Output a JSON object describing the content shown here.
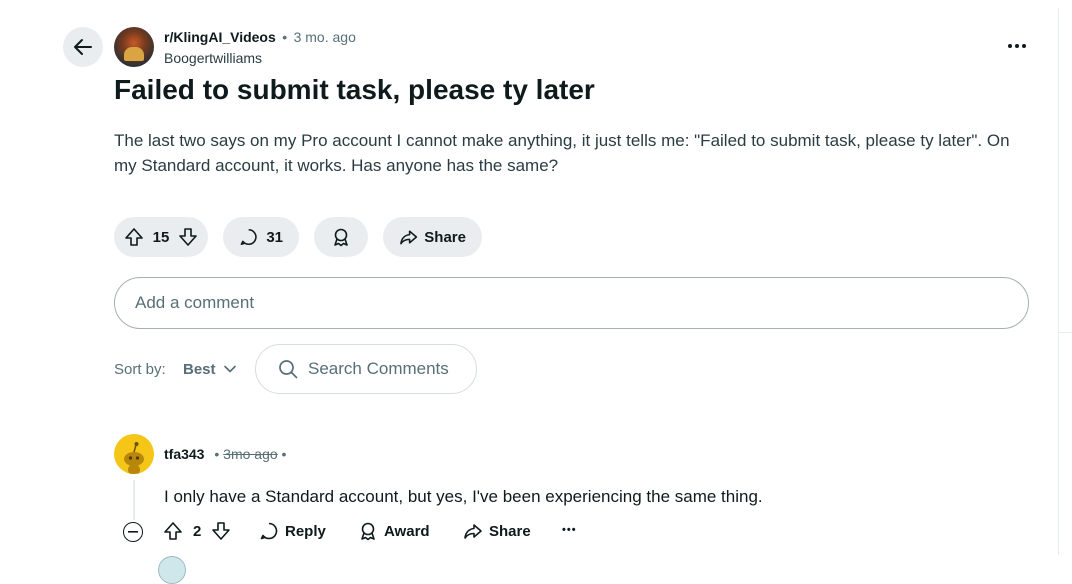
{
  "post": {
    "subreddit": "r/KlingAI_Videos",
    "separator": "•",
    "age": "3 mo. ago",
    "author": "Boogertwilliams",
    "title": "Failed to submit task, please ty later",
    "body": "The last two says on my Pro account I cannot make anything, it just tells me: \"Failed to submit task, please ty later\". On my Standard account, it works. Has anyone has the same?",
    "votes": "15",
    "comments_count": "31",
    "share_label": "Share",
    "more_icon": "more-horizontal-icon"
  },
  "comment_box": {
    "placeholder": "Add a comment"
  },
  "sort": {
    "label": "Sort by:",
    "value": "Best"
  },
  "search": {
    "placeholder": "Search Comments"
  },
  "comment": {
    "author": "tfa343",
    "separator": "•",
    "age": "3mo ago",
    "text": "I only have a Standard account, but yes, I've been experiencing the same thing.",
    "votes": "2",
    "reply_label": "Reply",
    "award_label": "Award",
    "share_label": "Share",
    "more_label": "•••"
  },
  "colors": {
    "pill_bg": "#e9edf0",
    "avatar_yellow": "#f5c518",
    "text": "#0f1a1c",
    "muted": "#576f76"
  }
}
